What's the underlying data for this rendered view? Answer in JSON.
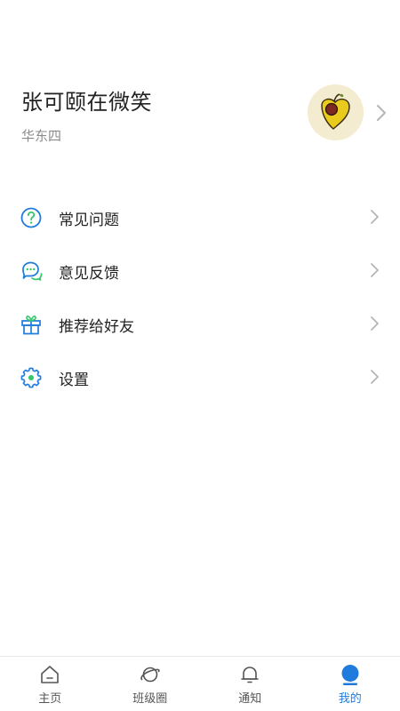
{
  "profile": {
    "name": "张可颐在微笑",
    "subtitle": "华东四",
    "avatar_icon": "fruit-heart-avatar"
  },
  "menu": {
    "items": [
      {
        "label": "常见问题",
        "icon": "question-circle-icon"
      },
      {
        "label": "意见反馈",
        "icon": "chat-bubbles-icon"
      },
      {
        "label": "推荐给好友",
        "icon": "gift-icon"
      },
      {
        "label": "设置",
        "icon": "gear-icon"
      }
    ]
  },
  "tabbar": {
    "tabs": [
      {
        "label": "主页",
        "icon": "home-icon",
        "active": false
      },
      {
        "label": "班级圈",
        "icon": "planet-icon",
        "active": false
      },
      {
        "label": "通知",
        "icon": "bell-icon",
        "active": false
      },
      {
        "label": "我的",
        "icon": "user-icon",
        "active": true
      }
    ]
  },
  "colors": {
    "accent": "#1f7bdc",
    "icon_blue": "#1f7bdc",
    "icon_green": "#34c76a",
    "chevron": "#b5b5b5",
    "text_primary": "#222222",
    "text_secondary": "#8a8a8a"
  }
}
